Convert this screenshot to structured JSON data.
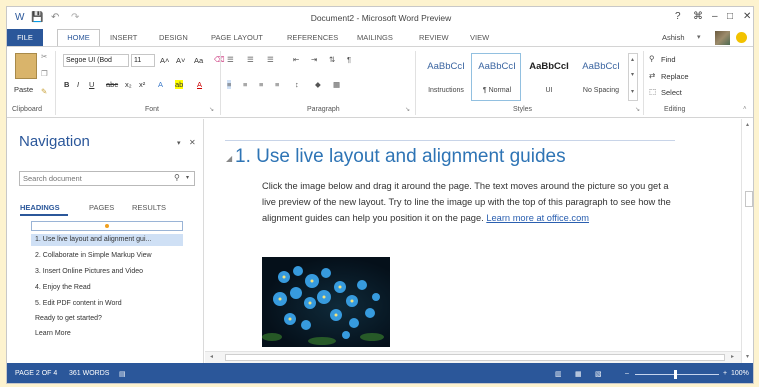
{
  "window": {
    "title": "Document2 - Microsoft Word Preview",
    "controls": {
      "help": "?",
      "restore_ribbon": "⌘",
      "minimize": "–",
      "maximize": "□",
      "close": "✕"
    },
    "quick_access": {
      "save": "💾",
      "undo": "↶",
      "redo": "↷"
    }
  },
  "ribbon_tabs": [
    "FILE",
    "HOME",
    "INSERT",
    "DESIGN",
    "PAGE LAYOUT",
    "REFERENCES",
    "MAILINGS",
    "REVIEW",
    "VIEW"
  ],
  "user": {
    "name": "Ashish"
  },
  "ribbon": {
    "clipboard": {
      "paste": "Paste",
      "label": "Clipboard"
    },
    "font": {
      "font_name": "Segoe UI (Bod",
      "font_size": "11",
      "grow": "A˄",
      "shrink": "A˅",
      "change_case": "Aa",
      "bold": "B",
      "italic": "I",
      "underline": "U",
      "strike": "abc",
      "subscript": "x₂",
      "superscript": "x²",
      "text_effects": "A",
      "highlight": "ab",
      "font_color": "A",
      "label": "Font"
    },
    "paragraph": {
      "label": "Paragraph"
    },
    "styles": {
      "label": "Styles",
      "items": [
        {
          "sample": "AaBbCcI",
          "name": "Instructions"
        },
        {
          "sample": "AaBbCcI",
          "name": "¶ Normal"
        },
        {
          "sample": "AaBbCcI",
          "name": "UI"
        },
        {
          "sample": "AaBbCcI",
          "name": "No Spacing"
        }
      ]
    },
    "editing": {
      "label": "Editing",
      "find": "Find",
      "replace": "Replace",
      "select": "Select"
    }
  },
  "navigation": {
    "title": "Navigation",
    "search_placeholder": "Search document",
    "tabs": [
      "HEADINGS",
      "PAGES",
      "RESULTS"
    ],
    "headings": [
      "1. Use live layout and alignment gui...",
      "2. Collaborate in Simple Markup View",
      "3. Insert Online Pictures and Video",
      "4. Enjoy the Read",
      "5. Edit PDF content in Word",
      "Ready to get started?",
      "Learn More"
    ]
  },
  "document": {
    "heading": "1. Use live layout and alignment guides",
    "paragraph": "Click the image below and drag it around the page. The text moves around the picture so you get a live preview of the new layout. Try to line the image up with the top of this paragraph to see how the alignment guides can help you position it on the page. ",
    "link_text": "Learn more at office.com"
  },
  "status": {
    "page": "PAGE 2 OF 4",
    "words": "361 WORDS",
    "zoom": "100%",
    "zoom_minus": "–",
    "zoom_plus": "+"
  },
  "colors": {
    "accent": "#2b579a",
    "heading": "#2e74b5",
    "link": "#2a5fb0"
  }
}
